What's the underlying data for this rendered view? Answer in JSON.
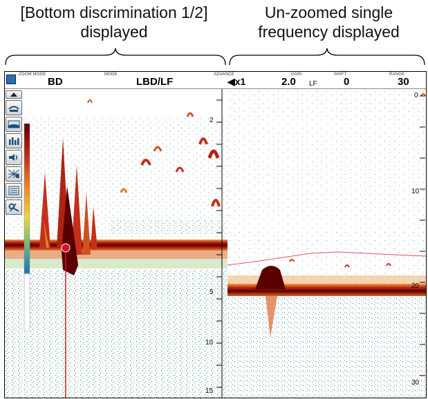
{
  "captions": {
    "left_line1": "[Bottom discrimination 1/2]",
    "left_line2": "displayed",
    "right_line1": "Un-zoomed single",
    "right_line2": "frequency displayed"
  },
  "topbar": {
    "zoom_mode_label": "ZOOM MODE",
    "zoom_mode_value": "BD",
    "mode_label": "MODE",
    "mode_value": "LBD/LF",
    "advance_label": "ADVANCE",
    "advance_value": "◀x1",
    "gain_label": "GAIN",
    "gain_value": "2.0",
    "gain_sub": "LF",
    "shift_label": "SHIFT",
    "shift_value": "0",
    "range_label": "RANGE",
    "range_value": "30"
  },
  "left_scale": [
    "2",
    "5",
    "10",
    "15"
  ],
  "right_scale": [
    "0",
    "10",
    "20",
    "30"
  ],
  "icons": [
    "up-arrow-icon",
    "boat-echo-icon",
    "bottom-profile-icon",
    "histogram-icon",
    "speaker-icon",
    "grid-chart-icon",
    "list-panel-icon",
    "settings-tools-icon"
  ],
  "colors": {
    "bottom": "#5a0000",
    "echo_red": "#c0281a",
    "echo_orange": "#e07a20",
    "echo_teal": "#3a9aaa",
    "pointer": "#d0142a"
  }
}
